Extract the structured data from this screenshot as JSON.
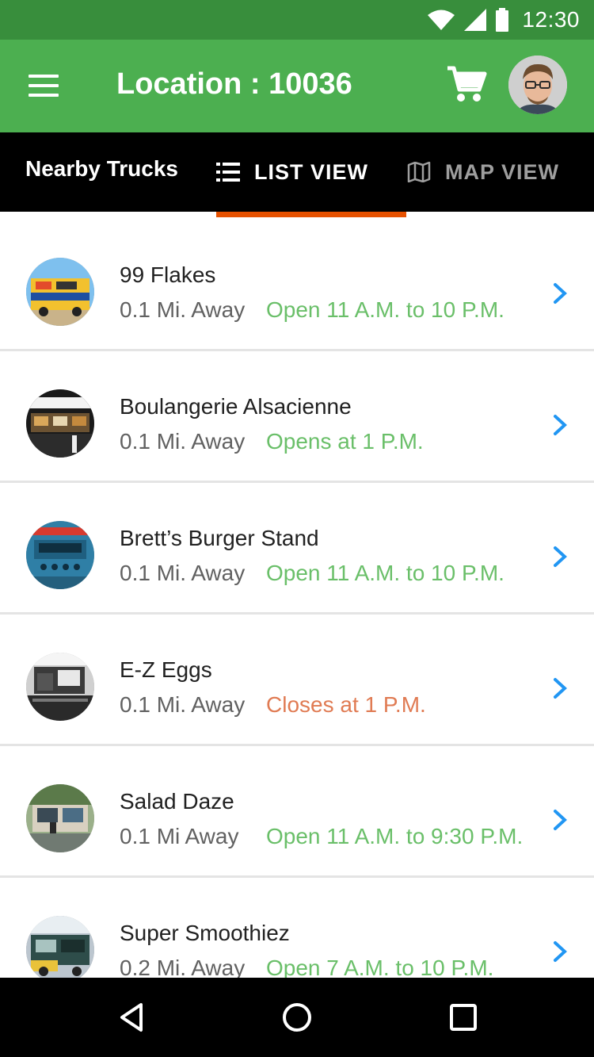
{
  "status_bar": {
    "time": "12:30",
    "icons": [
      "wifi-icon",
      "signal-icon",
      "battery-icon"
    ],
    "color": "#388e3c"
  },
  "app_bar": {
    "title": "Location : 10036",
    "menu_icon": "hamburger-menu-icon",
    "cart_icon": "cart-icon",
    "avatar_icon": "user-avatar",
    "color": "#4caf50"
  },
  "tab_bar": {
    "label": "Nearby Trucks",
    "tabs": [
      {
        "label": "LIST VIEW",
        "icon": "list-icon",
        "active": true
      },
      {
        "label": "MAP VIEW",
        "icon": "map-icon",
        "active": false
      }
    ],
    "indicator_color": "#e65100"
  },
  "trucks": [
    {
      "name": "99 Flakes",
      "distance": "0.1 Mi. Away",
      "hours": "Open 11 A.M. to 10 P.M.",
      "status": "open"
    },
    {
      "name": "Boulangerie Alsacienne",
      "distance": "0.1 Mi. Away",
      "hours": "Opens at 1 P.M.",
      "status": "open"
    },
    {
      "name": "Brett’s Burger Stand",
      "distance": "0.1 Mi. Away",
      "hours": "Open 11 A.M. to 10 P.M.",
      "status": "open"
    },
    {
      "name": "E-Z Eggs",
      "distance": "0.1 Mi. Away",
      "hours": "Closes at 1 P.M.",
      "status": "closing"
    },
    {
      "name": "Salad Daze",
      "distance": "0.1 Mi Away",
      "hours": "Open 11 A.M. to 9:30 P.M.",
      "status": "open"
    },
    {
      "name": "Super Smoothiez",
      "distance": "0.2 Mi. Away",
      "hours": "Open 7 A.M. to 10 P.M.",
      "status": "open"
    }
  ],
  "colors": {
    "open": "#6abf69",
    "closing": "#e07b53",
    "chevron": "#2196f3"
  },
  "nav_bar": {
    "icons": [
      "back-icon",
      "home-icon",
      "recents-icon"
    ]
  }
}
